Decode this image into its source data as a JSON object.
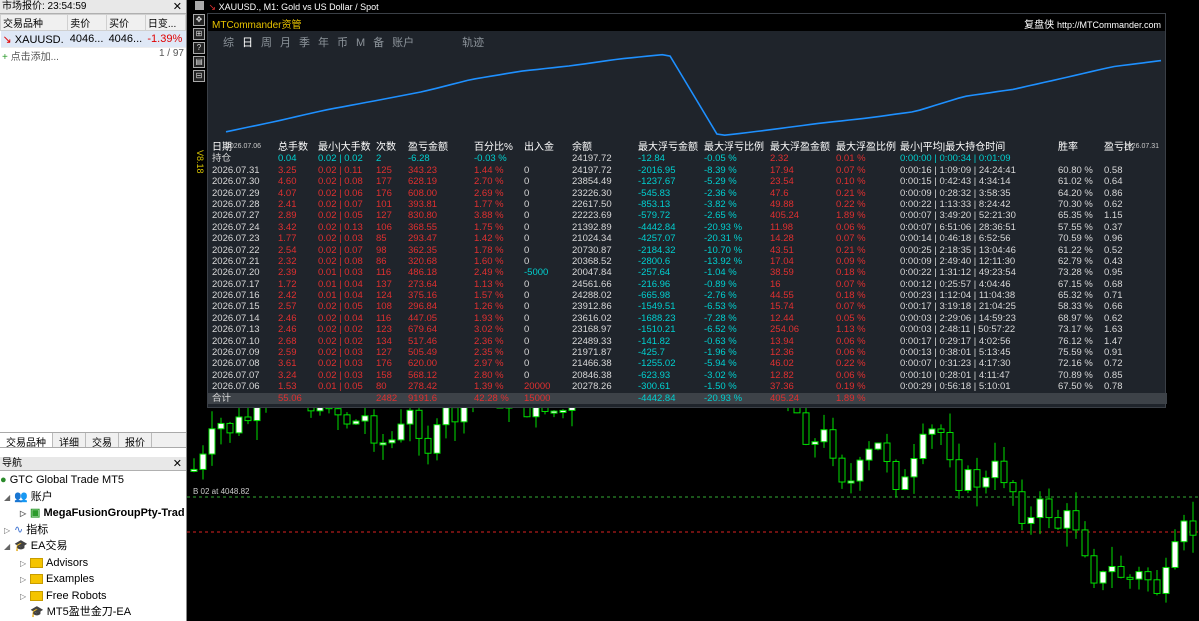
{
  "market_watch": {
    "title": "市场报价: 23:54:59",
    "close": "✕",
    "headers": [
      "交易品种",
      "卖价",
      "买价",
      "日变..."
    ],
    "row": {
      "symbol": "XAUUSD.",
      "bid": "4046...",
      "ask": "4046...",
      "change": "-1.39%"
    },
    "add_label": "点击添加...",
    "count": "1 / 97",
    "tabs": [
      "交易品种",
      "详细",
      "交易",
      "报价"
    ]
  },
  "navigator": {
    "title": "导航",
    "close": "✕",
    "items": [
      {
        "label": "GTC Global Trade MT5"
      },
      {
        "label": "账户"
      },
      {
        "label": "MegaFusionGroupPty-Trad"
      },
      {
        "label": "指标"
      },
      {
        "label": "EA交易"
      },
      {
        "label": "Advisors"
      },
      {
        "label": "Examples"
      },
      {
        "label": "Free Robots"
      },
      {
        "label": "MT5盈世金刀-EA"
      }
    ]
  },
  "chart": {
    "title": "XAUUSD., M1:  Gold vs US Dollar / Spot",
    "side_label": "V8.18",
    "price_line_label": "B     02 at 4048.82",
    "toolbar_glyphs": [
      "✥",
      "⊞",
      "?",
      "▤",
      "⊟"
    ]
  },
  "panel": {
    "title": "MTCommander资管",
    "right_title": "复盘侠",
    "url": "http://MTCommander.com",
    "tabs": [
      "综",
      "日",
      "周",
      "月",
      "季",
      "年",
      "币",
      "M",
      "备",
      "账户",
      "轨迹"
    ],
    "active_tab": "日",
    "equity_start_date": "2026.07.06",
    "equity_end_date": "2026.07.31",
    "headers": [
      "日期",
      "总手数",
      "最小|大手数",
      "次数",
      "盈亏金额",
      "百分比%",
      "出入金",
      "余额",
      "最大浮亏金额",
      "最大浮亏比例",
      "最大浮盈金额",
      "最大浮盈比例",
      "最小|平均|最大持仓时间",
      "胜率",
      "盈亏比"
    ],
    "holding": [
      "持仓",
      "0.04",
      "0.02 | 0.02",
      "2",
      "-6.28",
      "-0.03 %",
      "",
      "24197.72",
      "-12.84",
      "-0.05 %",
      "2.32",
      "0.01 %",
      "0:00:00 | 0:00:34 | 0:01:09",
      "",
      ""
    ],
    "rows": [
      [
        "2026.07.31",
        "3.25",
        "0.02 | 0.11",
        "125",
        "343.23",
        "1.44 %",
        "0",
        "24197.72",
        "-2016.95",
        "-8.39 %",
        "17.94",
        "0.07 %",
        "0:00:16 | 1:09:09 | 24:24:41",
        "60.80 %",
        "0.58"
      ],
      [
        "2026.07.30",
        "4.60",
        "0.02 | 0.08",
        "177",
        "628.19",
        "2.70 %",
        "0",
        "23854.49",
        "-1237.67",
        "-5.29 %",
        "23.54",
        "0.10 %",
        "0:00:15 | 0:42:43 | 4:34:14",
        "61.02 %",
        "0.64"
      ],
      [
        "2026.07.29",
        "4.07",
        "0.02 | 0.06",
        "176",
        "608.00",
        "2.69 %",
        "0",
        "23226.30",
        "-545.83",
        "-2.36 %",
        "47.6",
        "0.21 %",
        "0:00:09 | 0:28:32 | 3:58:35",
        "64.20 %",
        "0.86"
      ],
      [
        "2026.07.28",
        "2.41",
        "0.02 | 0.07",
        "101",
        "393.81",
        "1.77 %",
        "0",
        "22617.50",
        "-853.13",
        "-3.82 %",
        "49.88",
        "0.22 %",
        "0:00:22 | 1:13:33 | 8:24:42",
        "70.30 %",
        "0.62"
      ],
      [
        "2026.07.27",
        "2.89",
        "0.02 | 0.05",
        "127",
        "830.80",
        "3.88 %",
        "0",
        "22223.69",
        "-579.72",
        "-2.65 %",
        "405.24",
        "1.89 %",
        "0:00:07 | 3:49:20 | 52:21:30",
        "65.35 %",
        "1.15"
      ],
      [
        "2026.07.24",
        "3.42",
        "0.02 | 0.13",
        "106",
        "368.55",
        "1.75 %",
        "0",
        "21392.89",
        "-4442.84",
        "-20.93 %",
        "11.98",
        "0.06 %",
        "0:00:07 | 6:51:06 | 28:36:51",
        "57.55 %",
        "0.37"
      ],
      [
        "2026.07.23",
        "1.77",
        "0.02 | 0.03",
        "85",
        "293.47",
        "1.42 %",
        "0",
        "21024.34",
        "-4257.07",
        "-20.31 %",
        "14.28",
        "0.07 %",
        "0:00:14 | 0:46:18 | 6:52:56",
        "70.59 %",
        "0.96"
      ],
      [
        "2026.07.22",
        "2.54",
        "0.02 | 0.07",
        "98",
        "362.35",
        "1.78 %",
        "0",
        "20730.87",
        "-2184.32",
        "-10.70 %",
        "43.51",
        "0.21 %",
        "0:00:25 | 2:18:35 | 13:04:46",
        "61.22 %",
        "0.52"
      ],
      [
        "2026.07.21",
        "2.32",
        "0.02 | 0.08",
        "86",
        "320.68",
        "1.60 %",
        "0",
        "20368.52",
        "-2800.6",
        "-13.92 %",
        "17.04",
        "0.09 %",
        "0:00:09 | 2:49:40 | 12:11:30",
        "62.79 %",
        "0.43"
      ],
      [
        "2026.07.20",
        "2.39",
        "0.01 | 0.03",
        "116",
        "486.18",
        "2.49 %",
        "-5000",
        "20047.84",
        "-257.64",
        "-1.04 %",
        "38.59",
        "0.18 %",
        "0:00:22 | 1:31:12 | 49:23:54",
        "73.28 %",
        "0.95"
      ],
      [
        "2026.07.17",
        "1.72",
        "0.01 | 0.04",
        "137",
        "273.64",
        "1.13 %",
        "0",
        "24561.66",
        "-216.96",
        "-0.89 %",
        "16",
        "0.07 %",
        "0:00:12 | 0:25:57 | 4:04:46",
        "67.15 %",
        "0.68"
      ],
      [
        "2026.07.16",
        "2.42",
        "0.01 | 0.04",
        "124",
        "375.16",
        "1.57 %",
        "0",
        "24288.02",
        "-665.98",
        "-2.76 %",
        "44.55",
        "0.18 %",
        "0:00:23 | 1:12:04 | 11:04:38",
        "65.32 %",
        "0.71"
      ],
      [
        "2026.07.15",
        "2.57",
        "0.02 | 0.05",
        "108",
        "296.84",
        "1.26 %",
        "0",
        "23912.86",
        "-1549.51",
        "-6.53 %",
        "15.74",
        "0.07 %",
        "0:00:17 | 3:19:18 | 21:04:25",
        "58.33 %",
        "0.66"
      ],
      [
        "2026.07.14",
        "2.46",
        "0.02 | 0.04",
        "116",
        "447.05",
        "1.93 %",
        "0",
        "23616.02",
        "-1688.23",
        "-7.28 %",
        "12.44",
        "0.05 %",
        "0:00:03 | 2:29:06 | 14:59:23",
        "68.97 %",
        "0.62"
      ],
      [
        "2026.07.13",
        "2.46",
        "0.02 | 0.02",
        "123",
        "679.64",
        "3.02 %",
        "0",
        "23168.97",
        "-1510.21",
        "-6.52 %",
        "254.06",
        "1.13 %",
        "0:00:03 | 2:48:11 | 50:57:22",
        "73.17 %",
        "1.63"
      ],
      [
        "2026.07.10",
        "2.68",
        "0.02 | 0.02",
        "134",
        "517.46",
        "2.36 %",
        "0",
        "22489.33",
        "-141.82",
        "-0.63 %",
        "13.94",
        "0.06 %",
        "0:00:17 | 0:29:17 | 4:02:56",
        "76.12 %",
        "1.47"
      ],
      [
        "2026.07.09",
        "2.59",
        "0.02 | 0.03",
        "127",
        "505.49",
        "2.35 %",
        "0",
        "21971.87",
        "-425.7",
        "-1.96 %",
        "12.36",
        "0.06 %",
        "0:00:13 | 0:38:01 | 5:13:45",
        "75.59 %",
        "0.91"
      ],
      [
        "2026.07.08",
        "3.61",
        "0.02 | 0.03",
        "176",
        "620.00",
        "2.97 %",
        "0",
        "21466.38",
        "-1255.02",
        "-5.94 %",
        "46.02",
        "0.22 %",
        "0:00:07 | 0:31:23 | 4:17:30",
        "72.16 %",
        "0.72"
      ],
      [
        "2026.07.07",
        "3.24",
        "0.02 | 0.03",
        "158",
        "568.12",
        "2.80 %",
        "0",
        "20846.38",
        "-623.93",
        "-3.02 %",
        "12.82",
        "0.06 %",
        "0:00:10 | 0:28:01 | 4:11:47",
        "70.89 %",
        "0.85"
      ],
      [
        "2026.07.06",
        "1.53",
        "0.01 | 0.05",
        "80",
        "278.42",
        "1.39 %",
        "20000",
        "20278.26",
        "-300.61",
        "-1.50 %",
        "37.36",
        "0.19 %",
        "0:00:29 | 0:56:18 | 5:10:01",
        "67.50 %",
        "0.78"
      ]
    ],
    "total": [
      "合计",
      "55.06",
      "",
      "2482",
      "9191.6",
      "42.28 %",
      "15000",
      "",
      "-4442.84",
      "-20.93 %",
      "405.24",
      "1.89 %",
      "",
      "",
      ""
    ]
  },
  "colors": {
    "accent": "#1e90ff",
    "up": "#00e000",
    "down": "#e03030",
    "cyan": "#00d0d0",
    "gold": "#e8c300"
  }
}
